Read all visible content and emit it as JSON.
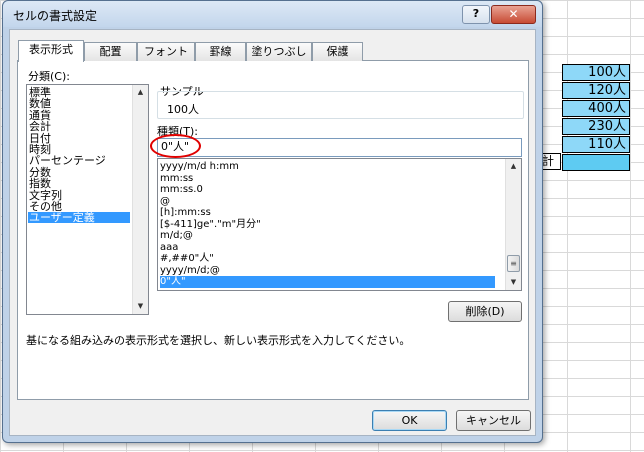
{
  "sheet": {
    "cells": [
      "100人",
      "120人",
      "400人",
      "230人",
      "110人",
      ""
    ],
    "kei_label": "計"
  },
  "dialog": {
    "title": "セルの書式設定",
    "help_label": "?",
    "close_label": "✕",
    "tabs": [
      "表示形式",
      "配置",
      "フォント",
      "罫線",
      "塗りつぶし",
      "保護"
    ],
    "category_label": "分類(C):",
    "categories": [
      "標準",
      "数値",
      "通貨",
      "会計",
      "日付",
      "時刻",
      "パーセンテージ",
      "分数",
      "指数",
      "文字列",
      "その他",
      "ユーザー定義"
    ],
    "selected_category": "ユーザー定義",
    "sample_label": "サンプル",
    "sample_value": "100人",
    "type_label": "種類(T):",
    "type_value": "0\"人\"",
    "formats": [
      "yyyy/m/d h:mm",
      "mm:ss",
      "mm:ss.0",
      "@",
      "[h]:mm:ss",
      "[$-411]ge\".\"m\"月分\"",
      "m/d;@",
      "aaa",
      "#,##0\"人\"",
      "yyyy/m/d;@",
      "0\"人\""
    ],
    "selected_format": "0\"人\"",
    "delete_label": "削除(D)",
    "description": "基になる組み込みの表示形式を選択し、新しい表示形式を入力してください。",
    "ok_label": "OK",
    "cancel_label": "キャンセル"
  },
  "colors": {
    "selection": "#3399ff",
    "cell_fill": "#8ed8f8",
    "highlight_circle": "#e00000"
  }
}
